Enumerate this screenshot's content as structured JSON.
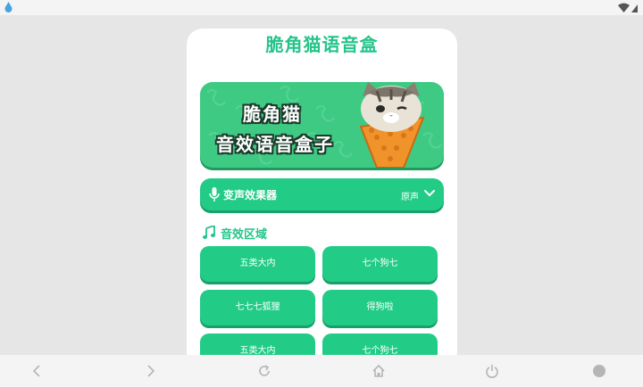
{
  "app": {
    "title": "脆角猫语音盒"
  },
  "banner": {
    "line1": "脆角猫",
    "line2": "音效语音盒子"
  },
  "voice_changer": {
    "label": "变声效果器",
    "selected": "原声"
  },
  "sound_section": {
    "label": "音效区域",
    "buttons": [
      "五类大内",
      "七个狗七",
      "七七七狐狸",
      "得狗啦",
      "五类大内",
      "七个狗七"
    ]
  },
  "colors": {
    "accent": "#24c48a",
    "button": "#22cc87",
    "background": "#e6e6e6"
  },
  "icons": {
    "status_left": "water-drop-icon",
    "status_right": [
      "wifi-icon",
      "signal-icon"
    ],
    "voice": "microphone-icon",
    "dropdown": "chevron-down-icon",
    "section": "music-note-icon",
    "nav": [
      "back-icon",
      "forward-icon",
      "refresh-icon",
      "home-icon",
      "power-icon",
      "circle-icon"
    ]
  }
}
